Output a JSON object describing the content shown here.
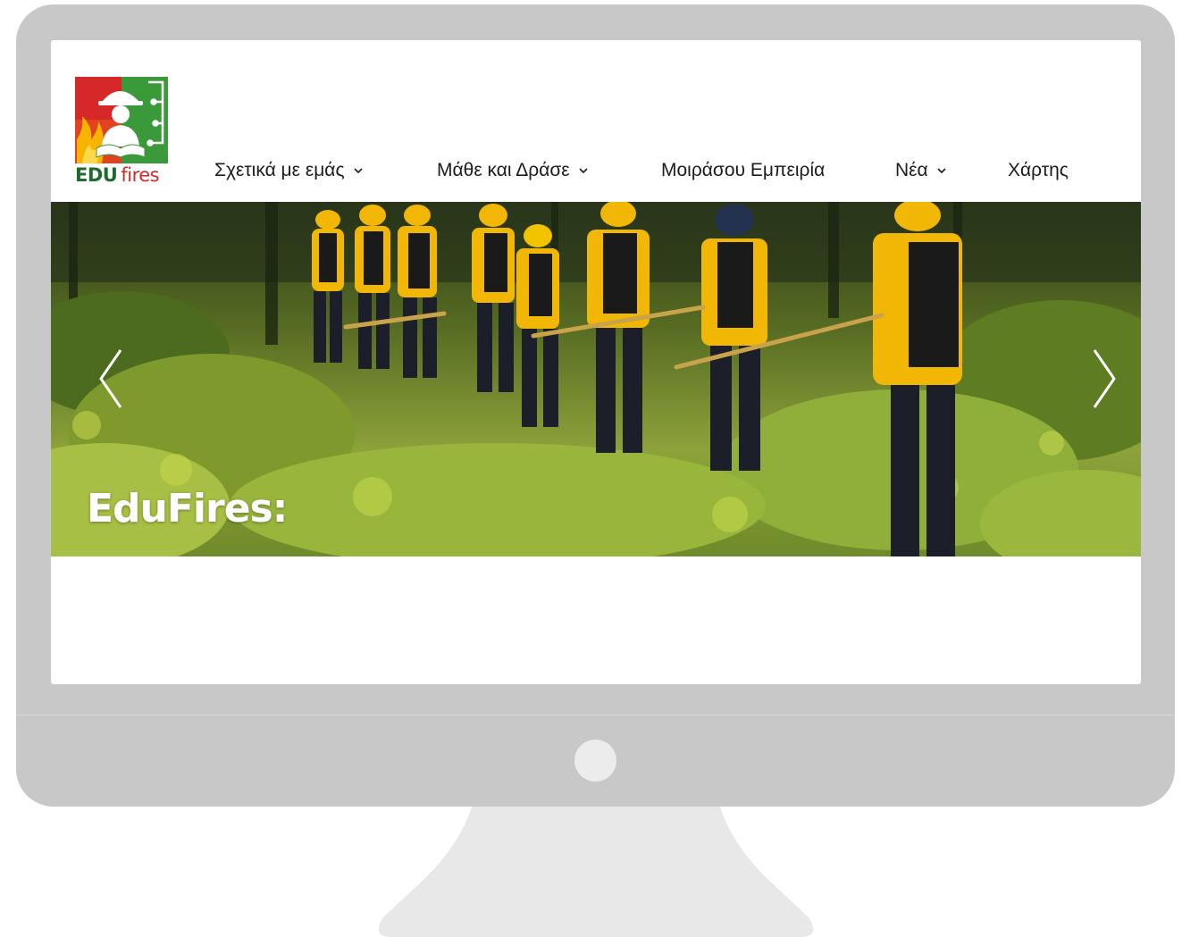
{
  "logo": {
    "text_bold": "EDU",
    "text_regular": "fires"
  },
  "nav": {
    "items": [
      {
        "label": "Σχετικά με εμάς",
        "has_dropdown": true
      },
      {
        "label": "Μάθε και Δράσε",
        "has_dropdown": true
      },
      {
        "label": "Μοιράσου Εμπειρία",
        "has_dropdown": false
      },
      {
        "label": "Νέα",
        "has_dropdown": true
      },
      {
        "label": "Χάρτης",
        "has_dropdown": false
      }
    ]
  },
  "hero": {
    "title": "EduFires:",
    "prev_icon": "chevron-left-icon",
    "next_icon": "chevron-right-icon"
  },
  "colors": {
    "monitor_frame": "#c8c8c8",
    "stand": "#e8e8e8",
    "logo_green": "#1f6a2e",
    "logo_red": "#d62828",
    "nav_text": "#1c1c1c",
    "uniform_yellow": "#f2b705"
  }
}
